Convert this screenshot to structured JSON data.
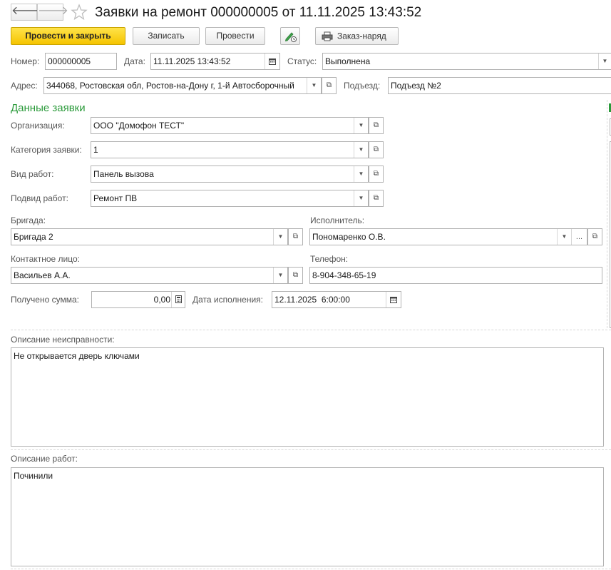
{
  "window": {
    "title": "Заявки на ремонт 000000005 от 11.11.2025 13:43:52"
  },
  "toolbar": {
    "post_close_label": "Провести и закрыть",
    "save_label": "Записать",
    "post_label": "Провести",
    "work_order_label": "Заказ-наряд"
  },
  "header": {
    "number_label": "Номер:",
    "number_value": "000000005",
    "date_label": "Дата:",
    "date_value": "11.11.2025 13:43:52",
    "status_label": "Статус:",
    "status_value": "Выполнена",
    "address_label": "Адрес:",
    "address_value": "344068, Ростовская обл, Ростов-на-Дону г, 1-й Автосборочный",
    "entrance_label": "Подъезд:",
    "entrance_value": "Подъезд №2"
  },
  "request_data": {
    "section_title": "Данные заявки",
    "organization_label": "Организация:",
    "organization_value": "ООО \"Домофон ТЕСТ\"",
    "category_label": "Категория заявки:",
    "category_value": "1",
    "work_type_label": "Вид работ:",
    "work_type_value": "Панель вызова",
    "work_subtype_label": "Подвид работ:",
    "work_subtype_value": "Ремонт ПВ",
    "brigade_label": "Бригада:",
    "brigade_value": "Бригада 2",
    "executor_label": "Исполнитель:",
    "executor_value": "Пономаренко О.В.",
    "contact_label": "Контактное лицо:",
    "contact_value": "Васильев А.А.",
    "phone_label": "Телефон:",
    "phone_value": "8-904-348-65-19",
    "amount_label": "Получено сумма:",
    "amount_value": "0,00",
    "exec_date_label": "Дата исполнения:",
    "exec_date_value": "12.11.2025  6:00:00"
  },
  "descriptions": {
    "fault_label": "Описание неисправности:",
    "fault_value": "Не открывается дверь ключами",
    "work_label": "Описание работ:",
    "work_value": "Починили"
  },
  "icons": {
    "back": "arrow-left-icon",
    "forward": "arrow-right-icon",
    "favorite": "star-icon",
    "edit": "pencil-clock-icon",
    "print": "printer-icon",
    "calendar": "calendar-icon",
    "calculator": "calculator-icon",
    "open": "open-object-icon",
    "dropdown": "chevron-down-icon",
    "select": "ellipsis-icon"
  },
  "colors": {
    "primary_button": "#f5c400",
    "section_title": "#2a9a3a"
  }
}
